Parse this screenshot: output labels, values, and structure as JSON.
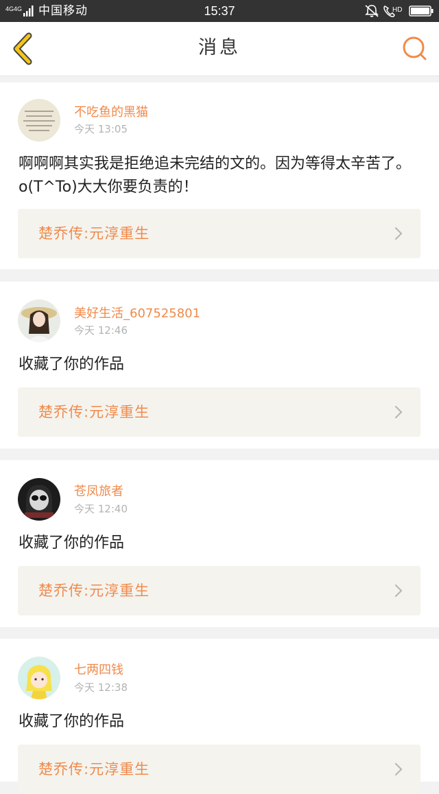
{
  "status_bar": {
    "network": "4G 4G",
    "carrier": "中国移动",
    "time": "15:37",
    "hd": "HD"
  },
  "header": {
    "title": "消息",
    "back_icon": "chevron-left-icon",
    "search_icon": "search-icon"
  },
  "messages": [
    {
      "username": "不吃鱼的黑猫",
      "time": "今天 13:05",
      "content": "啊啊啊其实我是拒绝追未完结的文的。因为等得太辛苦了。o(T^To)大大你要负责的！",
      "work_title": "楚乔传:元淳重生"
    },
    {
      "username": "美好生活_607525801",
      "time": "今天 12:46",
      "content": "收藏了你的作品",
      "work_title": "楚乔传:元淳重生"
    },
    {
      "username": "苍凤旅者",
      "time": "今天 12:40",
      "content": "收藏了你的作品",
      "work_title": "楚乔传:元淳重生"
    },
    {
      "username": "七两四钱",
      "time": "今天 12:38",
      "content": "收藏了你的作品",
      "work_title": "楚乔传:元淳重生"
    }
  ],
  "colors": {
    "accent": "#f08a4b",
    "back_icon": "#f5c518",
    "status_bar_bg": "#333333",
    "work_card_bg": "#f4f3ee"
  }
}
